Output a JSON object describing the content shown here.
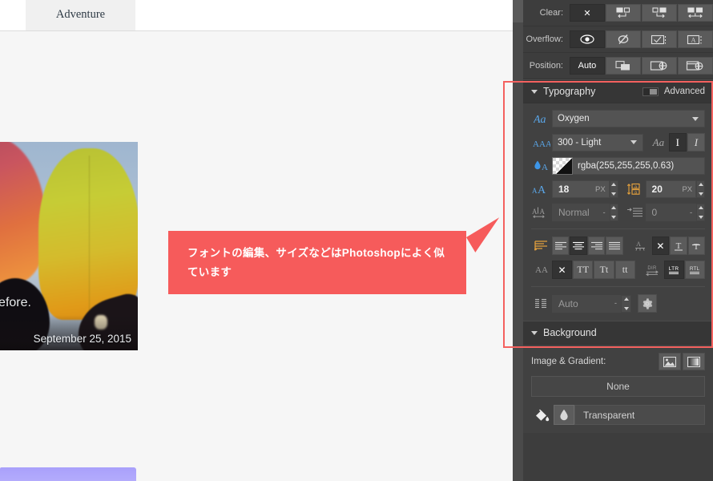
{
  "canvas": {
    "tab_label": "Adventure",
    "hero_caption": "een before.",
    "hero_date": "September 25, 2015"
  },
  "callout": {
    "text": "フォントの編集、サイズなどはPhotoshopによく似ています",
    "color": "#f65b5b"
  },
  "panel": {
    "top_rows": [
      {
        "label": "Clear:",
        "options": [
          {
            "name": "clear-none-icon",
            "glyph": "✕",
            "active": true
          },
          {
            "name": "clear-left-icon",
            "glyph": "",
            "active": false
          },
          {
            "name": "clear-right-icon",
            "glyph": "",
            "active": false
          },
          {
            "name": "clear-both-icon",
            "glyph": "",
            "active": false
          }
        ]
      },
      {
        "label": "Overflow:",
        "options": [
          {
            "name": "overflow-visible-icon",
            "glyph": "",
            "active": true
          },
          {
            "name": "overflow-hidden-icon",
            "glyph": "",
            "active": false
          },
          {
            "name": "overflow-scroll-icon",
            "glyph": "",
            "active": false
          },
          {
            "name": "overflow-auto-icon",
            "glyph": "",
            "active": false
          }
        ]
      },
      {
        "label": "Position:",
        "options": [
          {
            "name": "position-auto-button",
            "glyph": "Auto",
            "active": true
          },
          {
            "name": "position-relative-icon",
            "glyph": "",
            "active": false
          },
          {
            "name": "position-absolute-icon",
            "glyph": "",
            "active": false
          },
          {
            "name": "position-fixed-icon",
            "glyph": "",
            "active": false
          }
        ]
      }
    ],
    "typography": {
      "title": "Typography",
      "advanced_label": "Advanced",
      "font_family": "Oxygen",
      "font_weight": "300 - Light",
      "color_value": "rgba(255,255,255,0.63)",
      "font_size": "18",
      "font_size_unit": "PX",
      "line_height": "20",
      "line_height_unit": "PX",
      "letter_spacing_value": "Normal",
      "letter_spacing_suffix": "-",
      "indent_value": "0",
      "indent_suffix": "-",
      "columns_value": "Auto",
      "columns_suffix": "-",
      "style_aa": "Aa",
      "style_italic_1": "I",
      "style_italic_2": "I",
      "transform": {
        "label": "AA",
        "none": "✕",
        "uppercase": "TT",
        "capitalize": "Tt",
        "lowercase": "tt"
      },
      "decoration": {
        "none": "✕",
        "underline": "T",
        "strike": "T"
      },
      "direction": {
        "label": "DIR",
        "ltr": "LTR",
        "rtl": "RTL"
      }
    },
    "background": {
      "title": "Background",
      "image_gradient_label": "Image & Gradient:",
      "none_label": "None",
      "fill_label": "Transparent"
    }
  },
  "highlight": {
    "color": "#f4615f"
  }
}
